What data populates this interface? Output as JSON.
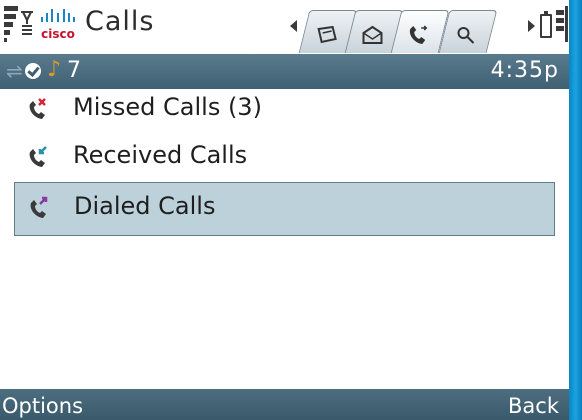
{
  "header": {
    "logo_text": "cisco",
    "title": "Calls",
    "tabs": [
      {
        "icon": "contacts-card-icon",
        "active": false
      },
      {
        "icon": "messages-envelope-icon",
        "active": false
      },
      {
        "icon": "calls-handset-icon",
        "active": true
      },
      {
        "icon": "directory-search-icon",
        "active": false
      }
    ]
  },
  "status": {
    "extension": "7",
    "time": "4:35p"
  },
  "calls_menu": {
    "items": [
      {
        "label": "Missed Calls (3)",
        "icon": "missed-call-icon"
      },
      {
        "label": "Received Calls",
        "icon": "received-call-icon"
      },
      {
        "label": "Dialed Calls",
        "icon": "dialed-call-icon",
        "selected": true
      }
    ]
  },
  "softkeys": {
    "left": "Options",
    "right": "Back"
  },
  "colors": {
    "statusbar": "#3f6072",
    "selection": "#bdd1db",
    "missed": "#d2243a",
    "received": "#2b8fb0",
    "dialed": "#8a3aa0",
    "bezel": "#1ba3e0"
  }
}
